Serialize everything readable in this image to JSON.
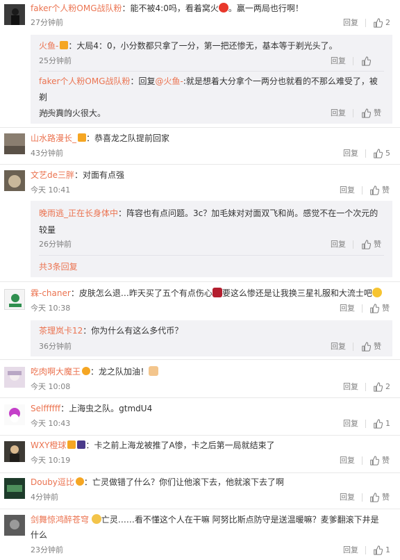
{
  "actions": {
    "reply": "回复",
    "like_label": "赞"
  },
  "c1": {
    "user": "faker个人粉OMG战队粉",
    "text": "能不被4:0吗，看着窝火",
    "text2": "。赢一两局也行啊！",
    "time": "27分钟前",
    "likes": "2",
    "replies": [
      {
        "user": "火鱼-",
        "text": "大局4：0，小分数都只拿了一分，第一把还惨无，基本等于剃光头了。",
        "time": "25分钟前"
      },
      {
        "user": "faker个人粉OMG战队粉",
        "text_a": "回复",
        "mention": "@火鱼-",
        "text_b": ":就是想着大分拿个一两分也就看的不那么难受了，被剃",
        "text_c": "光头真的火很大。",
        "time": "24分钟前",
        "likes": "赞"
      }
    ]
  },
  "c2": {
    "user": "山水路漫长_",
    "text": "恭喜龙之队提前回家",
    "time": "43分钟前",
    "likes": "5"
  },
  "c3": {
    "user": "文艺de三胖",
    "text": "对面有点强",
    "time": "今天 10:41",
    "likes": "赞",
    "reply": {
      "user": "晚雨逃_正在长身体中",
      "text": "阵容也有点问题。3c？加毛妹对对面双飞和尚。感觉不在一个次元的",
      "text2": "较量",
      "time": "26分钟前",
      "likes": "赞"
    },
    "more": "共3条回复"
  },
  "c4": {
    "user": "霖-chaner",
    "text": "皮肤怎么退…昨天买了五个有点伤心",
    "text2": "要这么惨还是让我换三星礼服和大流士吧",
    "time": "今天 10:38",
    "likes": "赞",
    "reply": {
      "user": "茶理岚卡12",
      "text": "你为什么有这么多代币？",
      "time": "36分钟前",
      "likes": "赞"
    }
  },
  "c5": {
    "user": "吃肉啊大魔王",
    "text": "龙之队加油！",
    "time": "今天 10:08",
    "likes": "2"
  },
  "c6": {
    "user": "Selffffff",
    "text": "上海虫之队。gtmdU4",
    "time": "今天 10:43",
    "likes": "1"
  },
  "c7": {
    "user": "WXY橙球",
    "text": "卡之前上海龙被推了A惨，卡之后第一局就结束了",
    "time": "今天 10:19",
    "likes": "赞"
  },
  "c8": {
    "user": "Douby逗比",
    "text": "亡灵做错了什么？你们让他滚下去，他就滚下去了啊",
    "time": "4分钟前",
    "likes": "赞"
  },
  "c9": {
    "user": "剑舞惊鸿醉苍穹",
    "text": "亡灵……看不懂这个人在干嘛 阿努比斯点防守是送温暖嘛？麦爹翻滚下井是",
    "text2": "什么",
    "time": "23分钟前",
    "likes": "1"
  },
  "colors": {
    "accent": "#eb7350",
    "muted": "#808080",
    "reply_bg": "#f2f2f5"
  },
  "icons": [
    "thumb-up-icon",
    "angry-emoji-icon",
    "broken-heart-icon",
    "laugh-cry-emoji-icon",
    "muscle-emoji-icon",
    "vip-crown-badge-icon",
    "verified-v-badge-icon"
  ]
}
